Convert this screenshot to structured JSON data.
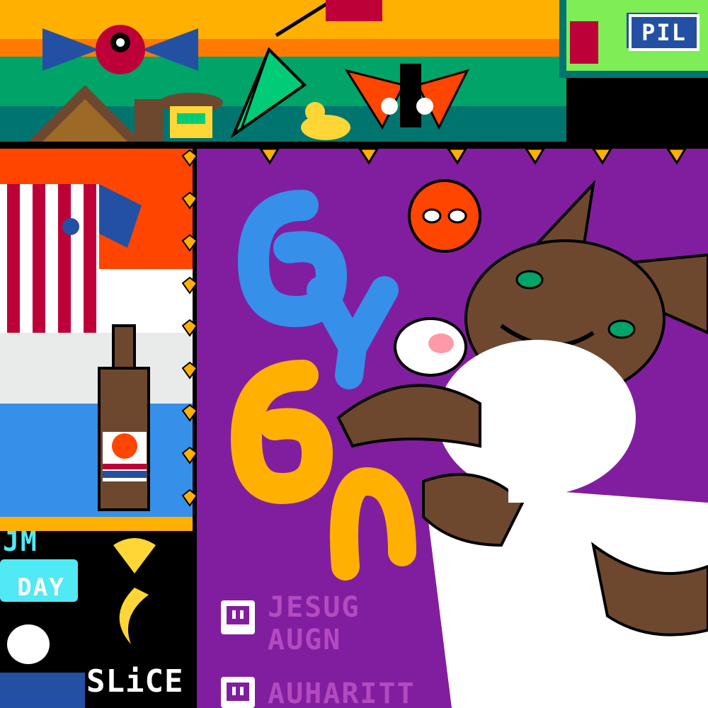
{
  "labels": {
    "pil": "PIL",
    "slice": "SLiCE",
    "day": "DAY",
    "jm": "JM",
    "twitch_line1": "JESUG",
    "twitch_line2": "AUGN",
    "twitch_line3": "AUHARITT"
  },
  "icons": {
    "twitch1": "twitch-logo-icon",
    "twitch2": "twitch-logo-icon",
    "spider": "spiderman-mask-icon",
    "heart": "heart-icon",
    "moon": "crescent-moon-icon"
  },
  "palette": {
    "yellow": "#FFB000",
    "orange": "#FF4500",
    "green": "#00A368",
    "dark_green": "#00756F",
    "purple": "#811E9F",
    "light_purple": "#B44AC0",
    "blue": "#3690EA",
    "light_blue": "#51E9F4",
    "red": "#BE0039",
    "white": "#FFFFFF",
    "brown": "#6D482F",
    "gold": "#FFD635",
    "black": "#000000"
  }
}
